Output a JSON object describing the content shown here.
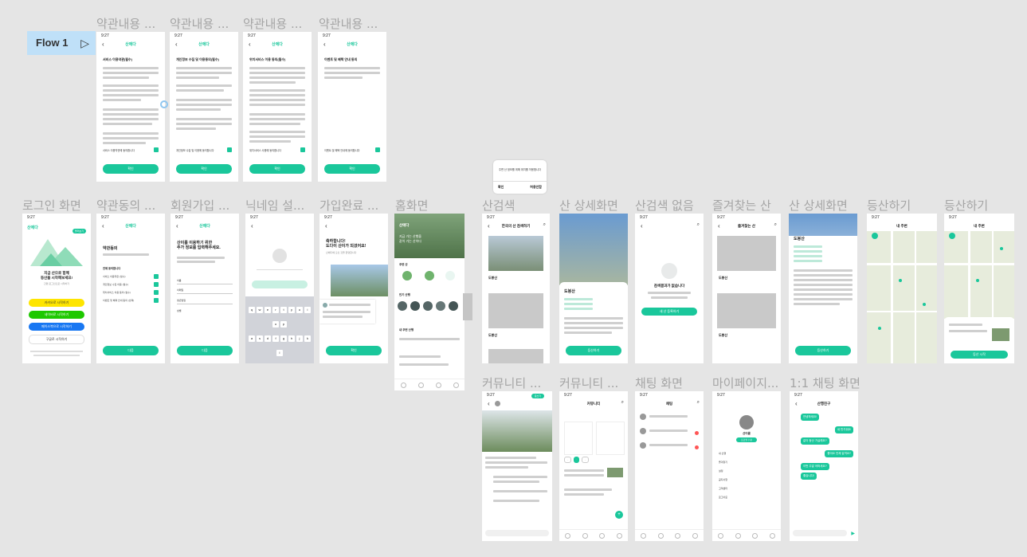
{
  "flow": {
    "label": "Flow 1",
    "arrow": "▷"
  },
  "labels": {
    "terms1": "약관내용 ...",
    "terms2": "약관내용 ...",
    "terms3": "약관내용 ...",
    "terms4": "약관내용 ...",
    "login": "로그인 화면",
    "agree": "약관동의 ...",
    "signup": "회원가입 ...",
    "nickname": "닉네임 설...",
    "complete": "가입완료 ...",
    "home": "홈화면",
    "search": "산검색",
    "detail1": "산 상세화면",
    "noresult": "산검색 없음",
    "favorite": "즐겨찾는 산",
    "detail2": "산 상세화면",
    "climb1": "등산하기",
    "climb2": "등산하기",
    "community1": "커뮤니티 ...",
    "community2": "커뮤니티 ...",
    "chat": "채팅 화면",
    "mypage": "마이페이지...",
    "chat11": "1:1 채팅 화면"
  },
  "common": {
    "time": "9:27",
    "logo": "산에다",
    "confirm": "확인",
    "next": "다음"
  },
  "terms": [
    {
      "title": "서비스 이용약관(필수)",
      "check": "서비스 이용약관에 동의합니다"
    },
    {
      "title": "개인정보 수집 및 이용동의(필수)",
      "check": "개인정보 수집 및 이용에 동의합니다"
    },
    {
      "title": "위치서비스 이용 동의(필수)",
      "check": "위치서비스 사용에 동의합니다"
    },
    {
      "title": "이벤트 및 혜택 안내 동의",
      "check": "이벤트 및 혜택 안내에 동의합니다"
    }
  ],
  "popup": {
    "text": "주변 산 정보를 위해 위치를 허용합니다",
    "cancel": "허용안함",
    "ok": "확인"
  },
  "login": {
    "badge": "둘러보기",
    "headline": "지금 산으로 함께\n등산을 시작해보세요!",
    "sub": "간편 로그인으로 시작하기",
    "kakao": "카카오로 시작하기",
    "naver": "네이버로 시작하기",
    "facebook": "페이스북으로 시작하기",
    "google": "구글로 시작하기"
  },
  "agree": {
    "title": "약관동의",
    "all": "전체 동의합니다",
    "items": [
      "서비스 이용약관 (필수)",
      "개인정보 수집 이용 (필수)",
      "위치서비스 이용 동의 (필수)",
      "이벤트 및 혜택 안내 동의 (선택)"
    ]
  },
  "signup": {
    "title": "산이를 이용하기 위한\n추가 정보를 입력해주세요.",
    "fields": [
      "이름",
      "이메일",
      "생년월일",
      "성별"
    ]
  },
  "complete": {
    "title": "축하합니다!\n도다이 산이가 되셨어요!",
    "sub": "산에다에 오신 것을 환영합니다"
  },
  "home": {
    "greeting": "지금 가는 산행을\n같이 가는 산이다",
    "section1": "주변 산",
    "section2": "인기 산행",
    "section3": "내 주변 산행"
  },
  "search": {
    "title": "한국의 산 검색하기",
    "mountain": "도봉산"
  },
  "detail": {
    "name": "도봉산",
    "button": "등산하기"
  },
  "noresult": {
    "title": "검색결과가 없습니다",
    "button": "새 산 등록하기"
  },
  "favorite": {
    "title": "즐겨찾는 산",
    "mountain": "도봉산"
  },
  "climb": {
    "title": "내 주변",
    "start": "등산 시작"
  },
  "community": {
    "title": "커뮤니티",
    "write": "글쓰기"
  },
  "chat": {
    "title": "채팅"
  },
  "mypage": {
    "name": "산이름",
    "edit": "프로필 수정",
    "menus": [
      "내 산행",
      "즐겨찾기",
      "설정",
      "공지사항",
      "고객센터",
      "로그아웃"
    ]
  },
  "chat11": {
    "title": "산행친구",
    "msgs": [
      "안녕하세요!",
      "네 반가워요",
      "같이 등산 가실래요?",
      "좋아요 언제 갈까요?",
      "이번 주말 어떠세요?",
      "좋습니다!"
    ]
  }
}
